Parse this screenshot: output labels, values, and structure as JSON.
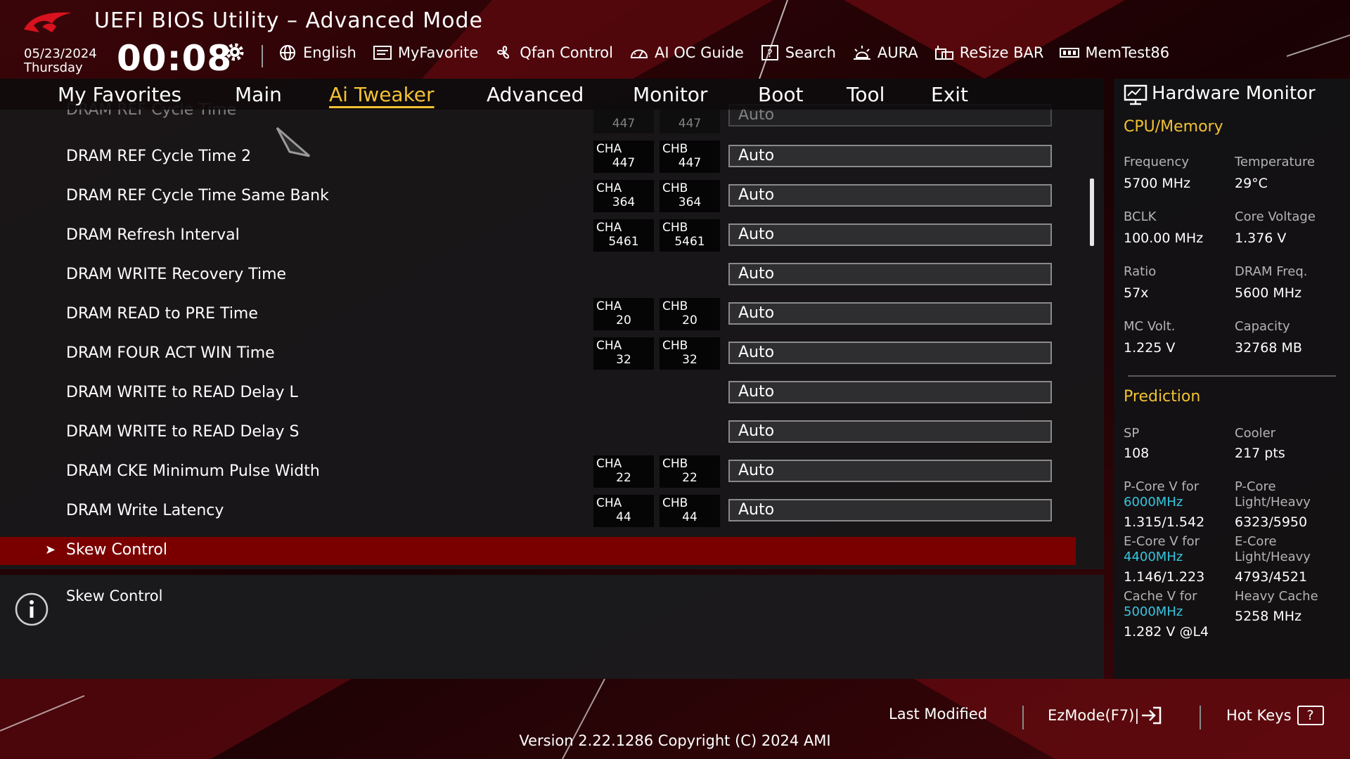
{
  "header": {
    "title": "UEFI BIOS Utility – Advanced Mode",
    "date": "05/23/2024",
    "weekday": "Thursday",
    "time": "00:08",
    "toolbar": [
      {
        "label": "English",
        "icon": "globe-icon"
      },
      {
        "label": "MyFavorite",
        "icon": "favorite-icon"
      },
      {
        "label": "Qfan Control",
        "icon": "fan-icon"
      },
      {
        "label": "AI OC Guide",
        "icon": "ai-oc-icon"
      },
      {
        "label": "Search",
        "icon": "search-icon"
      },
      {
        "label": "AURA",
        "icon": "aura-icon"
      },
      {
        "label": "ReSize BAR",
        "icon": "resize-bar-icon"
      },
      {
        "label": "MemTest86",
        "icon": "memtest-icon"
      }
    ]
  },
  "nav": {
    "tabs": [
      "My Favorites",
      "Main",
      "Ai Tweaker",
      "Advanced",
      "Monitor",
      "Boot",
      "Tool",
      "Exit"
    ],
    "active": "Ai Tweaker"
  },
  "settings": [
    {
      "label": "DRAM REF Cycle Time",
      "cha": "447",
      "chb": "447",
      "value": "Auto"
    },
    {
      "label": "DRAM REF Cycle Time 2",
      "cha": "447",
      "chb": "447",
      "value": "Auto"
    },
    {
      "label": "DRAM REF Cycle Time Same Bank",
      "cha": "364",
      "chb": "364",
      "value": "Auto"
    },
    {
      "label": "DRAM Refresh Interval",
      "cha": "5461",
      "chb": "5461",
      "value": "Auto"
    },
    {
      "label": "DRAM WRITE Recovery Time",
      "cha": "",
      "chb": "",
      "value": "Auto"
    },
    {
      "label": "DRAM READ to PRE Time",
      "cha": "20",
      "chb": "20",
      "value": "Auto"
    },
    {
      "label": "DRAM FOUR ACT WIN Time",
      "cha": "32",
      "chb": "32",
      "value": "Auto"
    },
    {
      "label": "DRAM WRITE to READ Delay L",
      "cha": "",
      "chb": "",
      "value": "Auto"
    },
    {
      "label": "DRAM WRITE to READ Delay S",
      "cha": "",
      "chb": "",
      "value": "Auto"
    },
    {
      "label": "DRAM CKE Minimum Pulse Width",
      "cha": "22",
      "chb": "22",
      "value": "Auto"
    },
    {
      "label": "DRAM Write Latency",
      "cha": "44",
      "chb": "44",
      "value": "Auto"
    }
  ],
  "channel_labels": {
    "a": "CHA",
    "b": "CHB"
  },
  "selected_item": {
    "arrow": "➤",
    "label": "Skew Control"
  },
  "description": "Skew Control",
  "hardware_monitor": {
    "title": "Hardware Monitor",
    "cpu_memory": {
      "section": "CPU/Memory",
      "frequency_label": "Frequency",
      "frequency": "5700 MHz",
      "temperature_label": "Temperature",
      "temperature": "29°C",
      "bclk_label": "BCLK",
      "bclk": "100.00 MHz",
      "core_voltage_label": "Core Voltage",
      "core_voltage": "1.376 V",
      "ratio_label": "Ratio",
      "ratio": "57x",
      "dram_freq_label": "DRAM Freq.",
      "dram_freq": "5600 MHz",
      "mc_volt_label": "MC Volt.",
      "mc_volt": "1.225 V",
      "capacity_label": "Capacity",
      "capacity": "32768 MB"
    },
    "prediction": {
      "section": "Prediction",
      "sp_label": "SP",
      "sp": "108",
      "cooler_label": "Cooler",
      "cooler": "217 pts",
      "pcore_v_label": "P-Core V for",
      "pcore_v_freq": "6000MHz",
      "pcore_v": "1.315/1.542",
      "pcore_lh_label_1": "P-Core",
      "pcore_lh_label_2": "Light/Heavy",
      "pcore_lh": "6323/5950",
      "ecore_v_label": "E-Core V for",
      "ecore_v_freq": "4400MHz",
      "ecore_v": "1.146/1.223",
      "ecore_lh_label_1": "E-Core",
      "ecore_lh_label_2": "Light/Heavy",
      "ecore_lh": "4793/4521",
      "cache_v_label": "Cache V for",
      "cache_v_freq": "5000MHz",
      "cache_v": "1.282 V @L4",
      "heavy_cache_label": "Heavy Cache",
      "heavy_cache": "5258 MHz"
    }
  },
  "footer": {
    "last_modified": "Last Modified",
    "ezmode": "EzMode(F7)|",
    "hot_keys": "Hot Keys",
    "hot_keys_key": "?",
    "version": "Version 2.22.1286 Copyright (C) 2024 AMI"
  },
  "colors": {
    "accent_gold": "#f2c233",
    "selection_red": "#7a0000",
    "link_cyan": "#36c6e0"
  }
}
